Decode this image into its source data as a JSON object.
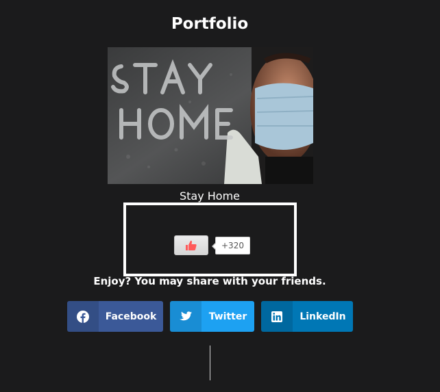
{
  "page": {
    "title": "Portfolio"
  },
  "portfolio_item": {
    "image_text": "STAY HOME",
    "caption": "Stay Home"
  },
  "like_widget": {
    "count": "+320",
    "icon": "thumbs-up-icon",
    "icon_color": "#ff5a5a"
  },
  "share": {
    "prompt": "Enjoy? You may share with your friends.",
    "buttons": [
      {
        "label": "Facebook",
        "icon": "facebook-icon",
        "color": "#3b5998"
      },
      {
        "label": "Twitter",
        "icon": "twitter-icon",
        "color": "#1da1f2"
      },
      {
        "label": "LinkedIn",
        "icon": "linkedin-icon",
        "color": "#0077b5"
      }
    ]
  },
  "colors": {
    "background": "#1b1b1c",
    "text": "#ffffff"
  }
}
